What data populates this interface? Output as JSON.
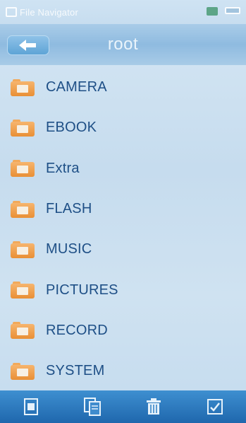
{
  "status_bar": {
    "app_title": "File Navigator",
    "icons": [
      "sd-card-icon",
      "battery-icon"
    ]
  },
  "path_bar": {
    "back_icon": "arrow-left-icon",
    "current_path": "root"
  },
  "folders": [
    {
      "label": "CAMERA",
      "icon": "folder-icon"
    },
    {
      "label": "EBOOK",
      "icon": "folder-icon"
    },
    {
      "label": "Extra",
      "icon": "folder-icon"
    },
    {
      "label": "FLASH",
      "icon": "folder-icon"
    },
    {
      "label": "MUSIC",
      "icon": "folder-icon"
    },
    {
      "label": "PICTURES",
      "icon": "folder-icon"
    },
    {
      "label": "RECORD",
      "icon": "folder-icon"
    },
    {
      "label": "SYSTEM",
      "icon": "folder-icon"
    }
  ],
  "toolbar": {
    "icons": [
      "properties-icon",
      "copy-icon",
      "delete-icon",
      "select-icon"
    ]
  },
  "colors": {
    "accent": "#2f7fc4",
    "folder": "#ee9b45",
    "label": "#1e4f86"
  }
}
